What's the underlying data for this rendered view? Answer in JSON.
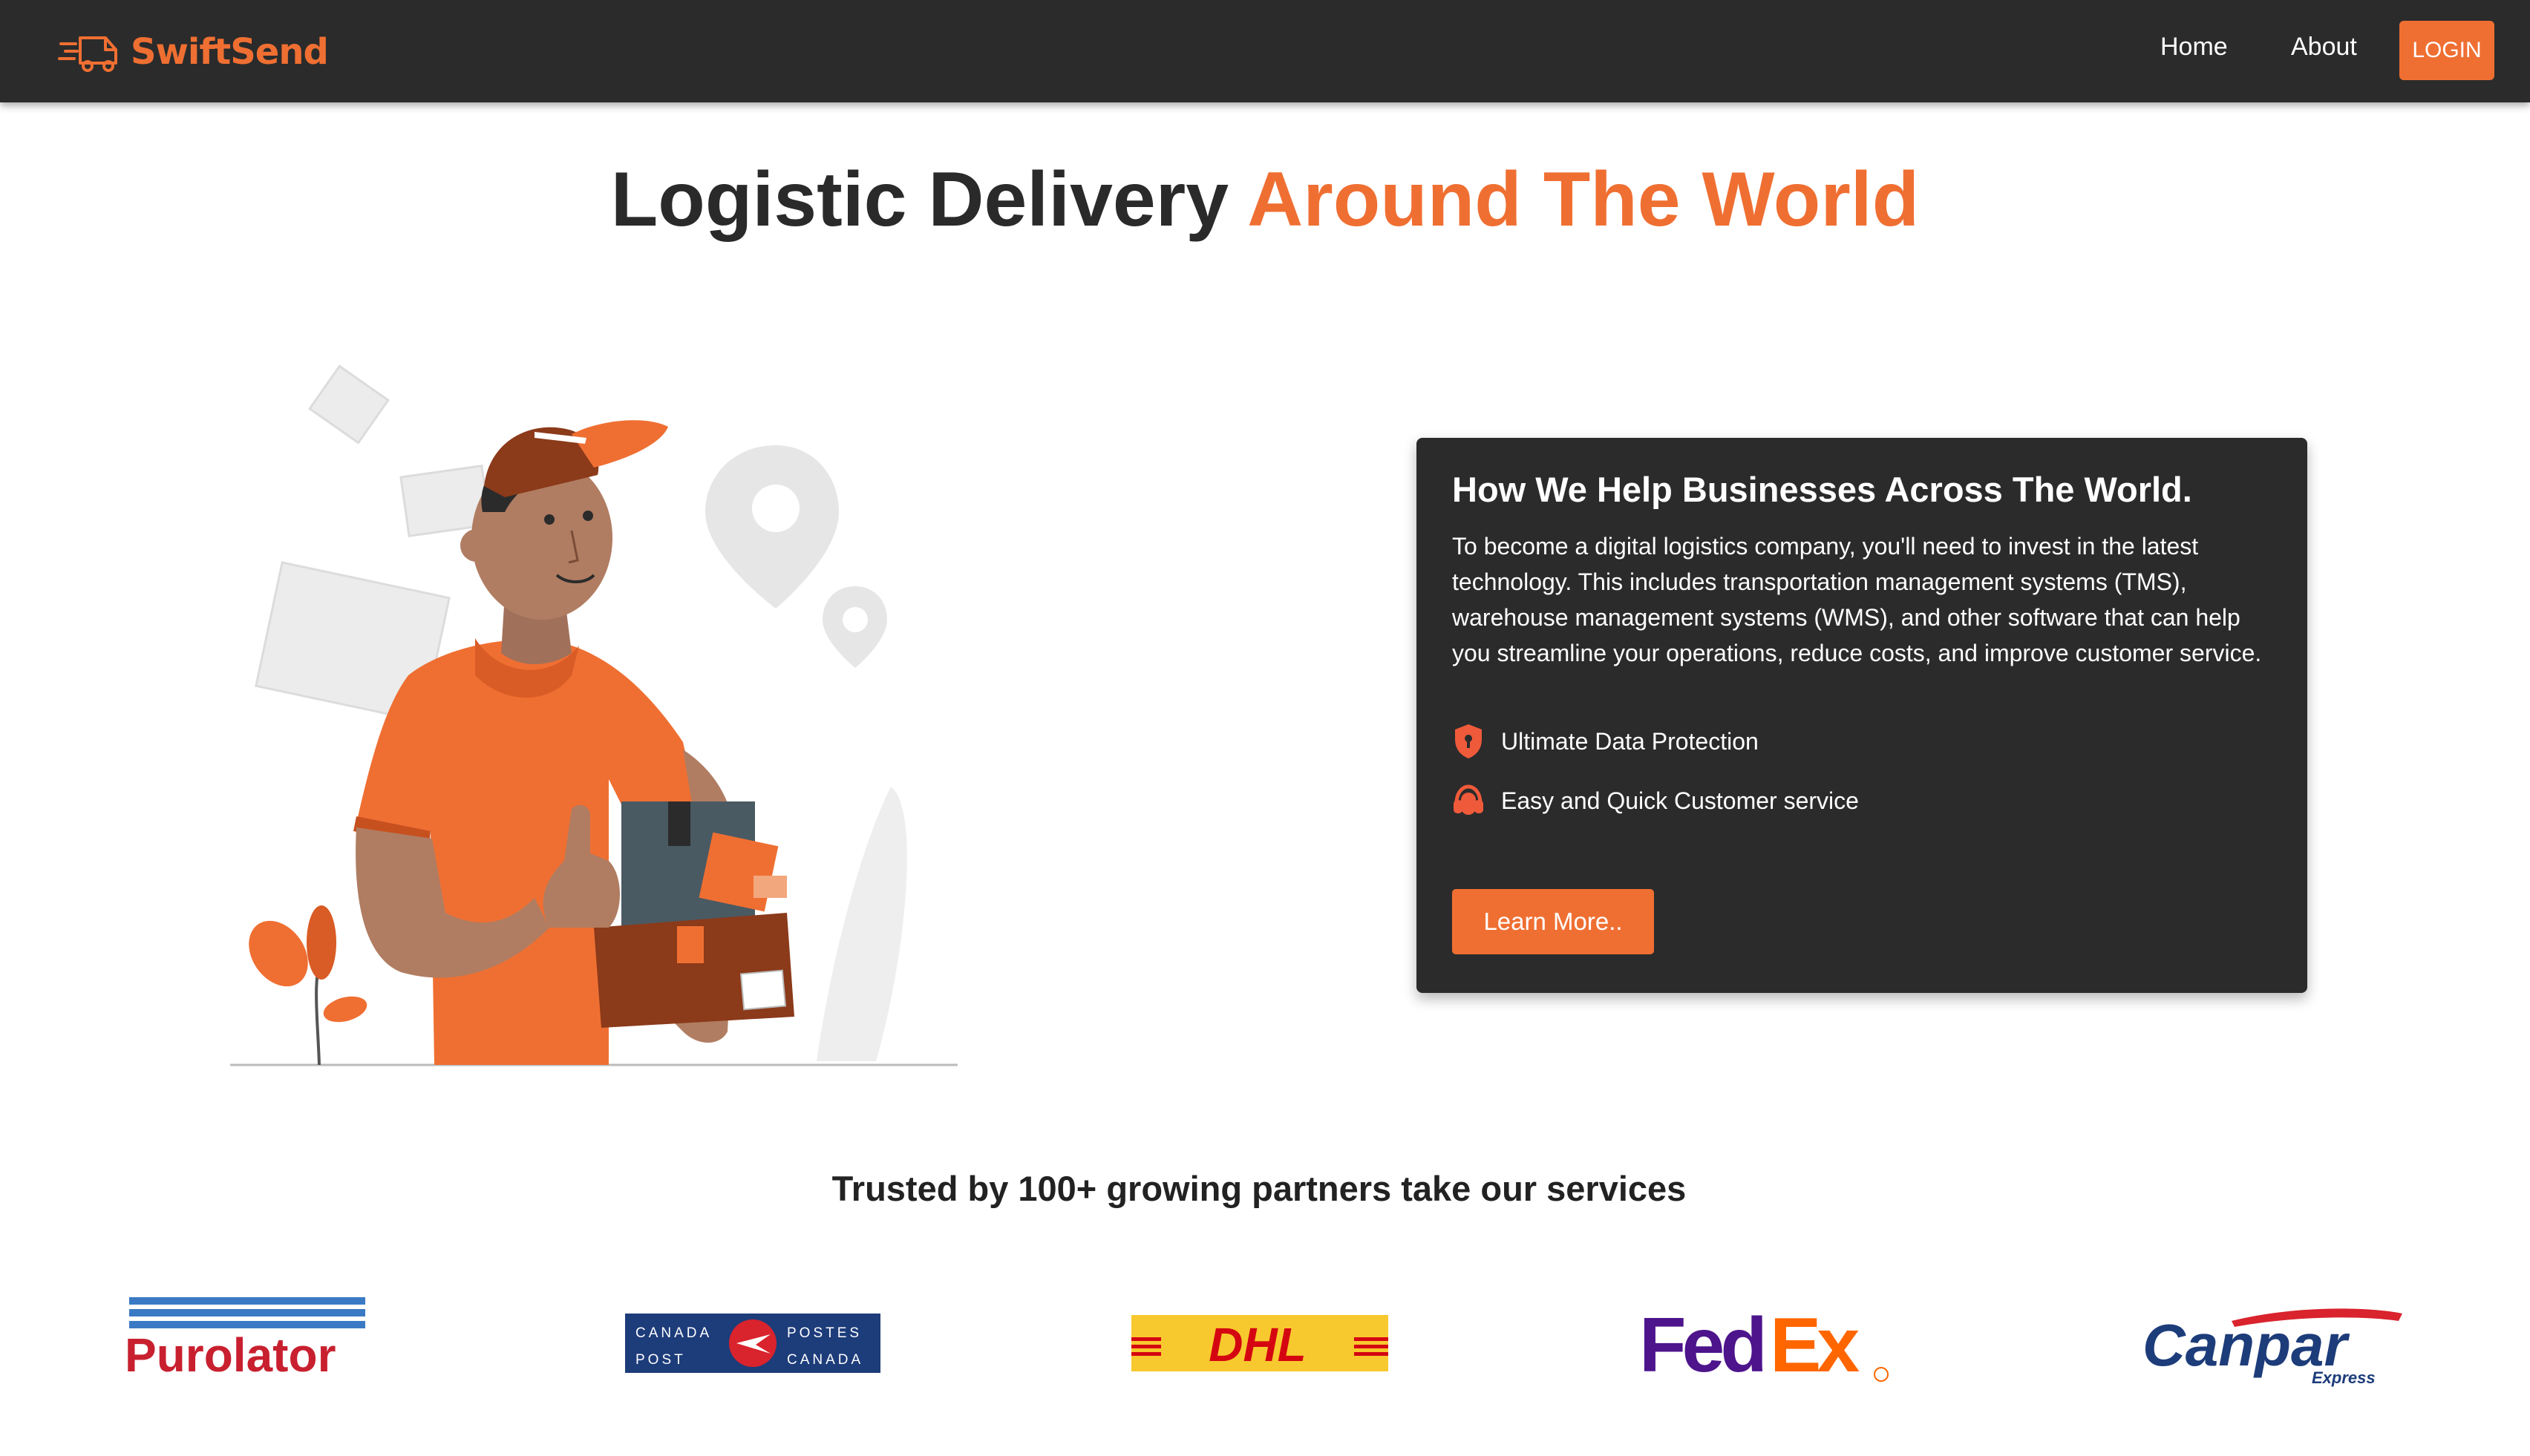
{
  "nav": {
    "brand": "SwiftSend",
    "links": [
      "Home",
      "About"
    ],
    "login_label": "LOGIN"
  },
  "hero": {
    "title_dark": "Logistic Delivery",
    "title_accent": "Around The World"
  },
  "card": {
    "title": "How We Help Businesses Across The World.",
    "body": "To become a digital logistics company, you'll need to invest in the latest technology. This includes transportation management systems (TMS), warehouse management systems (WMS), and other software that can help you streamline your operations, reduce costs, and improve customer service.",
    "features": [
      {
        "label": "Ultimate Data Protection",
        "icon": "shield-icon"
      },
      {
        "label": "Easy and Quick Customer service",
        "icon": "headset-icon"
      }
    ],
    "cta_label": "Learn More.."
  },
  "partners": {
    "heading": "Trusted by 100+ growing partners take our services",
    "logos": [
      {
        "name": "Purolator",
        "text": "Purolator"
      },
      {
        "name": "Canada Post",
        "text": [
          "CANADA",
          "POSTES",
          "POST",
          "CANADA"
        ]
      },
      {
        "name": "DHL",
        "text": "DHL"
      },
      {
        "name": "FedEx",
        "text": [
          "Fed",
          "Ex"
        ]
      },
      {
        "name": "Canpar",
        "text": [
          "Canpar",
          "Express"
        ]
      }
    ]
  },
  "colors": {
    "accent": "#ef6f32",
    "navbar": "#2b2b2b",
    "card": "#2b2b2b"
  }
}
